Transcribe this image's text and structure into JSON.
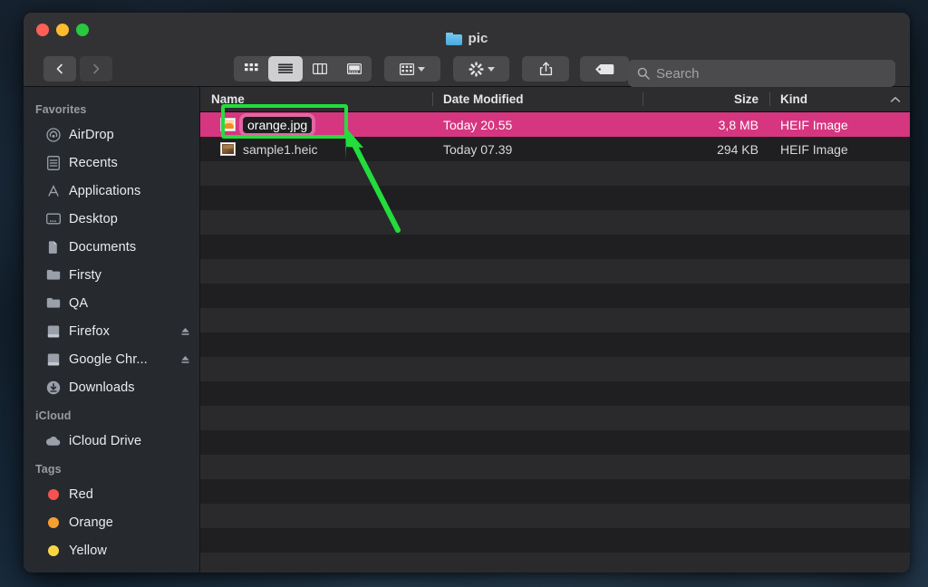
{
  "window": {
    "title": "pic",
    "title_icon": "folder-icon",
    "traffic_lights": [
      {
        "name": "close-button",
        "color": "#ff5f57"
      },
      {
        "name": "minimize-button",
        "color": "#febc2e"
      },
      {
        "name": "maximize-button",
        "color": "#28c840"
      }
    ]
  },
  "toolbar": {
    "back_icon": "chevron-left-icon",
    "forward_icon": "chevron-right-icon",
    "view_modes": [
      {
        "name": "icon-view",
        "icon": "grid-icon",
        "active": false
      },
      {
        "name": "list-view",
        "icon": "list-icon",
        "active": true
      },
      {
        "name": "column-view",
        "icon": "columns-icon",
        "active": false
      },
      {
        "name": "gallery-view",
        "icon": "gallery-icon",
        "active": false
      }
    ],
    "group_by": {
      "icon": "group-icon",
      "chevron": "chevron-down-icon"
    },
    "action": {
      "icon": "gear-icon",
      "chevron": "chevron-down-icon"
    },
    "share": {
      "icon": "share-icon"
    },
    "tags": {
      "icon": "tag-icon"
    }
  },
  "search": {
    "icon": "search-icon",
    "placeholder": "Search",
    "value": ""
  },
  "sidebar": {
    "sections": [
      {
        "header": "Favorites",
        "items": [
          {
            "label": "AirDrop",
            "icon": "airdrop-icon",
            "eject": false
          },
          {
            "label": "Recents",
            "icon": "recents-icon",
            "eject": false
          },
          {
            "label": "Applications",
            "icon": "applications-icon",
            "eject": false
          },
          {
            "label": "Desktop",
            "icon": "desktop-icon",
            "eject": false
          },
          {
            "label": "Documents",
            "icon": "documents-icon",
            "eject": false
          },
          {
            "label": "Firsty",
            "icon": "folder-icon",
            "eject": false
          },
          {
            "label": "QA",
            "icon": "folder-icon",
            "eject": false
          },
          {
            "label": "Firefox",
            "icon": "disk-icon",
            "eject": true
          },
          {
            "label": "Google Chr...",
            "icon": "disk-icon",
            "eject": true
          },
          {
            "label": "Downloads",
            "icon": "downloads-icon",
            "eject": false
          }
        ]
      },
      {
        "header": "iCloud",
        "items": [
          {
            "label": "iCloud Drive",
            "icon": "cloud-icon",
            "eject": false
          }
        ]
      },
      {
        "header": "Tags",
        "items": [
          {
            "label": "Red",
            "icon": "tag-dot-icon",
            "color": "#f4534f",
            "eject": false
          },
          {
            "label": "Orange",
            "icon": "tag-dot-icon",
            "color": "#f3a033",
            "eject": false
          },
          {
            "label": "Yellow",
            "icon": "tag-dot-icon",
            "color": "#f7d644",
            "eject": false
          }
        ]
      }
    ]
  },
  "file_list": {
    "columns": [
      {
        "label": "Name",
        "key": "name"
      },
      {
        "label": "Date Modified",
        "key": "date"
      },
      {
        "label": "Size",
        "key": "size"
      },
      {
        "label": "Kind",
        "key": "kind"
      }
    ],
    "sort_indicator": "chevron-up-icon",
    "rows": [
      {
        "name": "orange.jpg",
        "date": "Today 20.55",
        "size": "3,8 MB",
        "kind": "HEIF Image",
        "icon": "image-thumbnail-orange",
        "selected": true,
        "editing": true
      },
      {
        "name": "sample1.heic",
        "date": "Today 07.39",
        "size": "294 KB",
        "kind": "HEIF Image",
        "icon": "image-thumbnail-heic",
        "selected": false,
        "editing": false
      }
    ],
    "empty_row_count": 17
  },
  "annotations": {
    "highlight_box": {
      "name": "rename-field-highlight",
      "color": "#22dd3c"
    },
    "arrow": {
      "name": "pointer-arrow",
      "color": "#22dd3c"
    }
  },
  "colors": {
    "selection": "#d5367f",
    "rename_glow": "#ee82b9",
    "annotation_green": "#22dd3c",
    "window_chrome": "#323234",
    "sidebar_bg": "#26292e"
  }
}
